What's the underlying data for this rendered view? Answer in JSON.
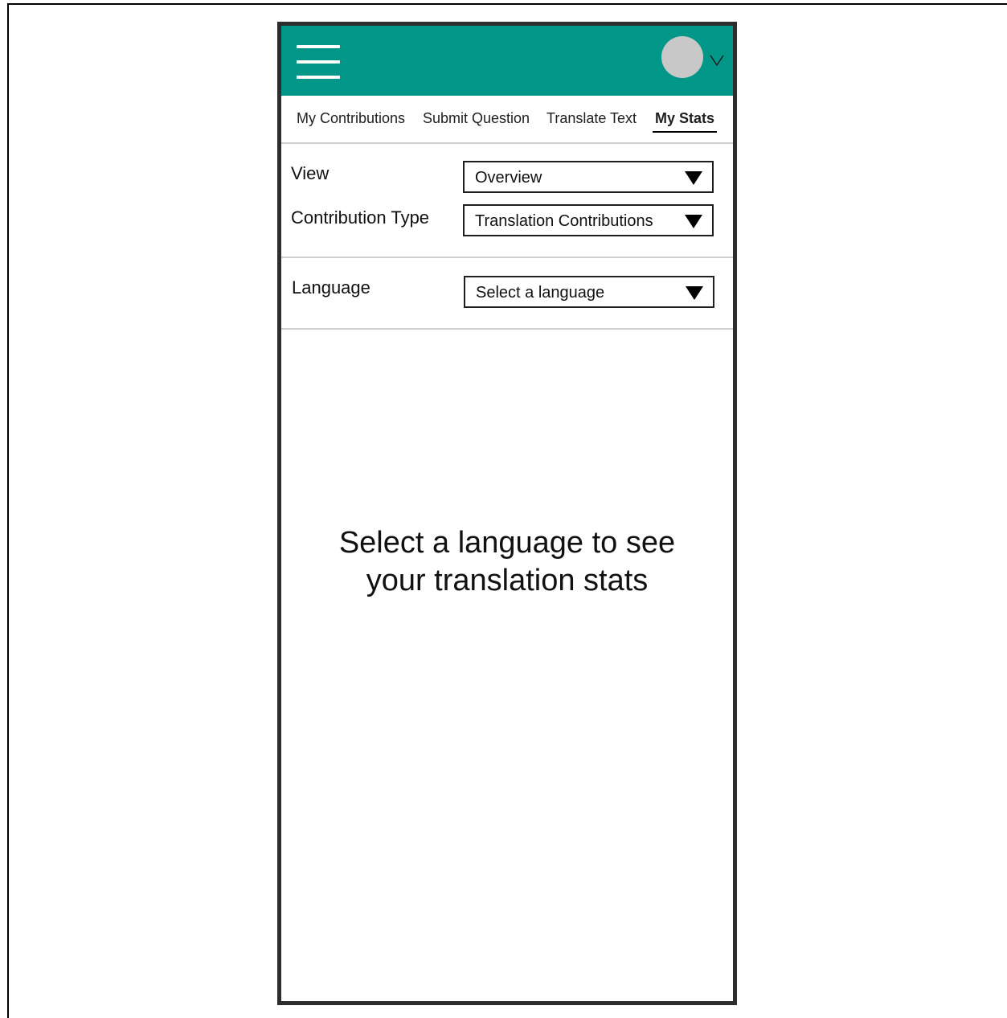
{
  "tabs": [
    {
      "label": "My Contributions",
      "active": false
    },
    {
      "label": "Submit Question",
      "active": false
    },
    {
      "label": "Translate Text",
      "active": false
    },
    {
      "label": "My Stats",
      "active": true
    }
  ],
  "filters": {
    "view": {
      "label": "View",
      "value": "Overview"
    },
    "contribution_type": {
      "label": "Contribution Type",
      "value": "Translation Contributions"
    },
    "language": {
      "label": "Language",
      "value": "Select a language"
    }
  },
  "empty_state": {
    "line1": "Select a language to see",
    "line2": "your translation stats"
  },
  "colors": {
    "app_bar": "#009688",
    "avatar": "#c8c8c8"
  },
  "icons": {
    "menu": "hamburger-menu-icon",
    "profile": "avatar",
    "profile_menu": "chevron-down-icon",
    "dropdown": "triangle-down-icon"
  }
}
